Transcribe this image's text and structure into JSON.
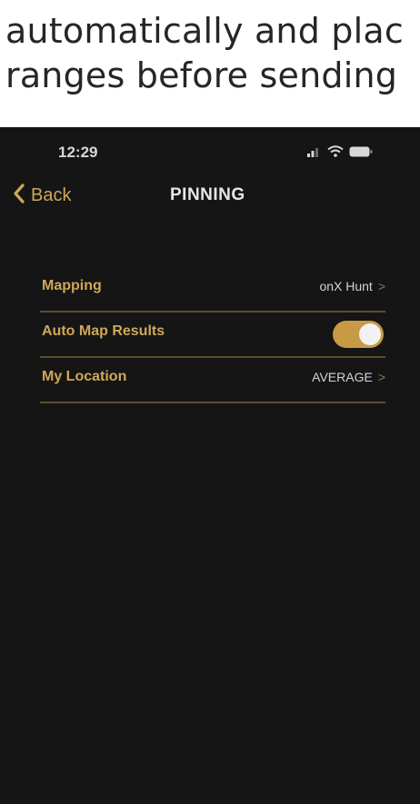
{
  "document": {
    "line1": "automatically and plac",
    "line2": "ranges before sending"
  },
  "status_bar": {
    "time": "12:29",
    "icons": [
      "signal-icon",
      "wifi-icon",
      "battery-icon"
    ]
  },
  "nav": {
    "back_label": "Back",
    "title": "PINNING"
  },
  "settings": {
    "mapping": {
      "label": "Mapping",
      "value": "onX Hunt",
      "chevron": ">"
    },
    "auto_map": {
      "label": "Auto Map Results",
      "toggle_on": true
    },
    "my_location": {
      "label": "My Location",
      "value": "AVERAGE",
      "chevron": ">"
    }
  },
  "colors": {
    "background": "#151515",
    "accent": "#cfa75a",
    "toggle_on": "#c89a45",
    "divider": "#5c4e30",
    "text": "#d4d4d4"
  }
}
